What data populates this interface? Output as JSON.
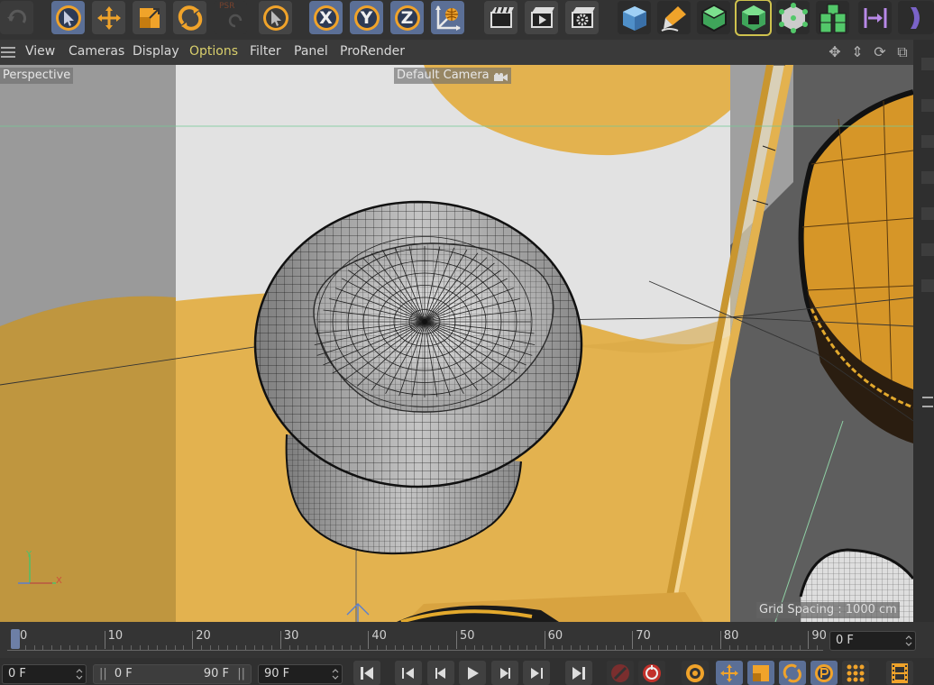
{
  "menu": {
    "items": [
      "View",
      "Cameras",
      "Display",
      "Options",
      "Filter",
      "Panel",
      "ProRender"
    ],
    "highlighted_index": 3
  },
  "toolbar": {
    "axis_x": "X",
    "axis_y": "Y",
    "axis_z": "Z",
    "psr": "PSR",
    "icons": [
      "undo-icon",
      "select-arrow-icon",
      "move-icon",
      "scale-icon",
      "rotate-icon",
      "psr-icon",
      "live-select-icon",
      "x-axis-icon",
      "y-axis-icon",
      "z-axis-icon",
      "world-coordinates-icon",
      "render-region-icon",
      "render-view-icon",
      "render-settings-icon",
      "cube-icon",
      "pen-icon",
      "subdivision-icon",
      "extrude-icon",
      "mograph-cloner-icon",
      "array-icon",
      "align-icon",
      "deformer-icon"
    ]
  },
  "viewport": {
    "view_name": "Perspective",
    "camera_label": "Default Camera",
    "grid_spacing": "Grid Spacing : 1000 cm",
    "axis_y": "Y",
    "axis_x": "X"
  },
  "timeline": {
    "ticks": [
      "0",
      "10",
      "20",
      "30",
      "40",
      "50",
      "60",
      "70",
      "80",
      "90"
    ],
    "current_frame": "0 F"
  },
  "transport": {
    "start_frame": "0 F",
    "range_start": "0 F",
    "range_end": "90 F",
    "end_frame": "90 F"
  },
  "colors": {
    "accent_orange": "#f0a32a",
    "active_blue": "#5b6f96",
    "menu_highlight": "#d9cf6c",
    "backdrop_yellow": "#e3b24f",
    "cube_cyan": "#6fb0e0",
    "green": "#53c86a"
  }
}
